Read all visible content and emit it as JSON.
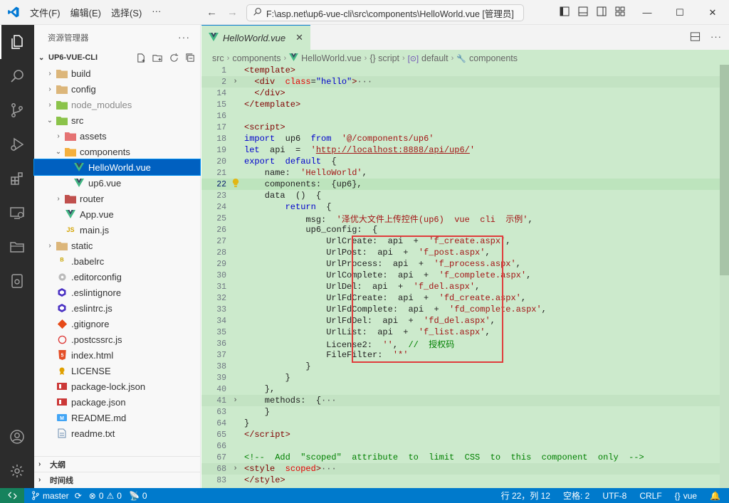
{
  "titlebar": {
    "menu": [
      "文件(F)",
      "编辑(E)",
      "选择(S)",
      "···"
    ],
    "command_center": "F:\\asp.net\\up6-vue-cli\\src\\components\\HelloWorld.vue [管理员]"
  },
  "sidebar": {
    "title": "资源管理器",
    "more": "···",
    "project": "UP6-VUE-CLI",
    "tree": [
      {
        "label": "build",
        "chev": "›",
        "indent": 0,
        "icon": "folder-icon"
      },
      {
        "label": "config",
        "chev": "›",
        "indent": 0,
        "icon": "folder-icon"
      },
      {
        "label": "node_modules",
        "chev": "›",
        "indent": 0,
        "icon": "folder-green-icon",
        "dim": true
      },
      {
        "label": "src",
        "chev": "⌄",
        "indent": 0,
        "icon": "folder-green-icon"
      },
      {
        "label": "assets",
        "chev": "›",
        "indent": 1,
        "icon": "folder-red-icon"
      },
      {
        "label": "components",
        "chev": "⌄",
        "indent": 1,
        "icon": "folder-orange-icon"
      },
      {
        "label": "HelloWorld.vue",
        "chev": "",
        "indent": 2,
        "icon": "vue-icon",
        "selected": true
      },
      {
        "label": "up6.vue",
        "chev": "",
        "indent": 2,
        "icon": "vue-icon"
      },
      {
        "label": "router",
        "chev": "›",
        "indent": 1,
        "icon": "folder-router-icon"
      },
      {
        "label": "App.vue",
        "chev": "",
        "indent": 1,
        "icon": "vue-icon"
      },
      {
        "label": "main.js",
        "chev": "",
        "indent": 1,
        "icon": "js-icon"
      },
      {
        "label": "static",
        "chev": "›",
        "indent": 0,
        "icon": "folder-icon"
      },
      {
        "label": ".babelrc",
        "chev": "",
        "indent": 0,
        "icon": "babel-icon"
      },
      {
        "label": ".editorconfig",
        "chev": "",
        "indent": 0,
        "icon": "editorconfig-icon"
      },
      {
        "label": ".eslintignore",
        "chev": "",
        "indent": 0,
        "icon": "eslint-icon"
      },
      {
        "label": ".eslintrc.js",
        "chev": "",
        "indent": 0,
        "icon": "eslint-icon"
      },
      {
        "label": ".gitignore",
        "chev": "",
        "indent": 0,
        "icon": "git-icon"
      },
      {
        "label": ".postcssrc.js",
        "chev": "",
        "indent": 0,
        "icon": "postcss-icon"
      },
      {
        "label": "index.html",
        "chev": "",
        "indent": 0,
        "icon": "html-icon"
      },
      {
        "label": "LICENSE",
        "chev": "",
        "indent": 0,
        "icon": "license-icon"
      },
      {
        "label": "package-lock.json",
        "chev": "",
        "indent": 0,
        "icon": "npm-icon"
      },
      {
        "label": "package.json",
        "chev": "",
        "indent": 0,
        "icon": "npm-icon"
      },
      {
        "label": "README.md",
        "chev": "",
        "indent": 0,
        "icon": "markdown-icon"
      },
      {
        "label": "readme.txt",
        "chev": "",
        "indent": 0,
        "icon": "text-icon"
      }
    ],
    "outline": "大纲",
    "timeline": "时间线"
  },
  "editor": {
    "tab": "HelloWorld.vue",
    "breadcrumb": [
      "src",
      "components",
      "HelloWorld.vue",
      "{} script",
      "default",
      "components"
    ],
    "lines": [
      {
        "n": "1",
        "html": "<span class='t'>&lt;template&gt;</span>"
      },
      {
        "n": "2",
        "fold": "›",
        "html": "  <span class='t'>&lt;div</span>  <span class='a'>class</span>=<span class='k'>\"hello\"</span><span class='t'>&gt;</span><span class='ell'>···</span>",
        "cur2": true
      },
      {
        "n": "14",
        "html": "  <span class='t'>&lt;/div&gt;</span>"
      },
      {
        "n": "15",
        "html": "<span class='t'>&lt;/template&gt;</span>"
      },
      {
        "n": "16",
        "html": ""
      },
      {
        "n": "17",
        "html": "<span class='t'>&lt;script&gt;</span>"
      },
      {
        "n": "18",
        "html": "<span class='k'>import</span>  up6  <span class='k'>from</span>  <span class='s'>'@/components/up6'</span>"
      },
      {
        "n": "19",
        "html": "<span class='k'>let</span>  api  =  <span class='s'>'</span><span class='u'>http://localhost:8888/api/up6/</span><span class='s'>'</span>"
      },
      {
        "n": "20",
        "html": "<span class='k'>export</span>  <span class='k'>default</span>  {"
      },
      {
        "n": "21",
        "html": "    name:  <span class='s'>'HelloWorld'</span>,"
      },
      {
        "n": "22",
        "html": "    components:  {up6},",
        "current": true
      },
      {
        "n": "23",
        "html": "    data  ()  {"
      },
      {
        "n": "24",
        "html": "        <span class='k'>return</span>  {"
      },
      {
        "n": "25",
        "html": "            msg:  <span class='s'>'泽优大文件上传控件(up6)  vue  cli  示例'</span>,"
      },
      {
        "n": "26",
        "html": "            up6_config:  {"
      },
      {
        "n": "27",
        "html": "                UrlCreate:  api  +  <span class='s'>'f_create.aspx'</span>,"
      },
      {
        "n": "28",
        "html": "                UrlPost:  api  +  <span class='s'>'f_post.aspx'</span>,"
      },
      {
        "n": "29",
        "html": "                UrlProcess:  api  +  <span class='s'>'f_process.aspx'</span>,"
      },
      {
        "n": "30",
        "html": "                UrlComplete:  api  +  <span class='s'>'f_complete.aspx'</span>,"
      },
      {
        "n": "31",
        "html": "                UrlDel:  api  +  <span class='s'>'f_del.aspx'</span>,"
      },
      {
        "n": "32",
        "html": "                UrlFdCreate:  api  +  <span class='s'>'fd_create.aspx'</span>,"
      },
      {
        "n": "33",
        "html": "                UrlFdComplete:  api  +  <span class='s'>'fd_complete.aspx'</span>,"
      },
      {
        "n": "34",
        "html": "                UrlFdDel:  api  +  <span class='s'>'fd_del.aspx'</span>,"
      },
      {
        "n": "35",
        "html": "                UrlList:  api  +  <span class='s'>'f_list.aspx'</span>,"
      },
      {
        "n": "36",
        "html": "                License2:  <span class='s'>''</span>,  <span class='c'>//  授权码</span>"
      },
      {
        "n": "37",
        "html": "                FileFilter:  <span class='s'>'*'</span>"
      },
      {
        "n": "38",
        "html": "            }"
      },
      {
        "n": "39",
        "html": "        }"
      },
      {
        "n": "40",
        "html": "    },"
      },
      {
        "n": "41",
        "fold": "›",
        "html": "    methods:  {<span class='ell'>···</span>",
        "cur2": true
      },
      {
        "n": "63",
        "html": "    }"
      },
      {
        "n": "64",
        "html": "}"
      },
      {
        "n": "65",
        "html": "<span class='t'>&lt;/script&gt;</span>"
      },
      {
        "n": "66",
        "html": ""
      },
      {
        "n": "67",
        "html": "<span class='c'>&lt;!--  Add  \"scoped\"  attribute  to  limit  CSS  to  this  component  only  --&gt;</span>"
      },
      {
        "n": "68",
        "fold": "›",
        "html": "<span class='t'>&lt;style</span>  <span class='a'>scoped</span><span class='t'>&gt;</span><span class='ell'>···</span>",
        "cur2": true
      },
      {
        "n": "83",
        "html": "<span class='t'>&lt;/style&gt;</span>"
      }
    ]
  },
  "status": {
    "branch": "master",
    "problems": "0",
    "warnings": "0",
    "ports": "0",
    "position": "行 22，列 12",
    "spaces": "空格: 2",
    "encoding": "UTF-8",
    "eol": "CRLF",
    "language": "vue"
  }
}
